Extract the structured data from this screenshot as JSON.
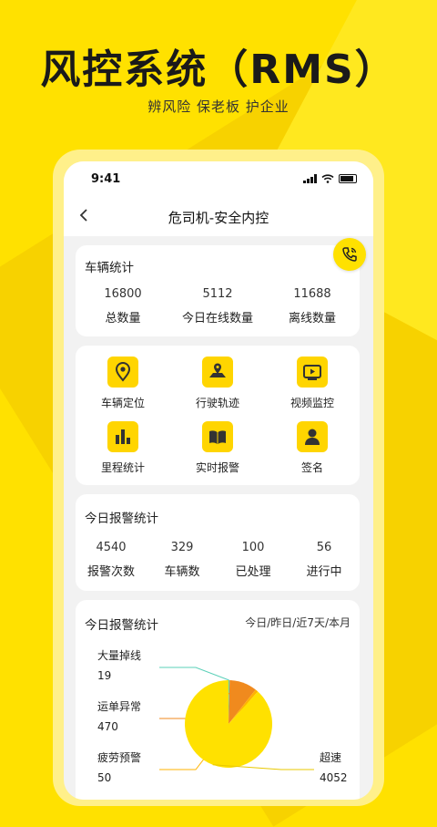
{
  "hero": {
    "title": "风控系统（RMS）",
    "subtitle": "辨风险 保老板 护企业"
  },
  "statusbar": {
    "time": "9:41"
  },
  "nav": {
    "back_icon": "chevron-left-icon",
    "title": "危司机-安全内控"
  },
  "vehicle_stats": {
    "title": "车辆统计",
    "items": [
      {
        "value": "16800",
        "label": "总数量"
      },
      {
        "value": "5112",
        "label": "今日在线数量"
      },
      {
        "value": "11688",
        "label": "离线数量"
      }
    ]
  },
  "functions": [
    {
      "label": "车辆定位",
      "icon": "location-pin-icon"
    },
    {
      "label": "行驶轨迹",
      "icon": "map-route-icon"
    },
    {
      "label": "视频监控",
      "icon": "video-play-icon"
    },
    {
      "label": "里程统计",
      "icon": "bar-chart-icon"
    },
    {
      "label": "实时报警",
      "icon": "book-icon"
    },
    {
      "label": "签名",
      "icon": "person-icon"
    }
  ],
  "alarm_stats": {
    "title": "今日报警统计",
    "items": [
      {
        "value": "4540",
        "label": "报警次数"
      },
      {
        "value": "329",
        "label": "车辆数"
      },
      {
        "value": "100",
        "label": "已处理"
      },
      {
        "value": "56",
        "label": "进行中"
      }
    ]
  },
  "alarm_chart": {
    "title": "今日报警统计",
    "range": "今日/昨日/近7天/本月"
  },
  "chart_data": {
    "type": "pie",
    "slices": [
      {
        "label": "大量掉线",
        "value": 19,
        "color": "#5BD0B8"
      },
      {
        "label": "运单异常",
        "value": 470,
        "color": "#F08A1E"
      },
      {
        "label": "疲劳预警",
        "value": 50,
        "color": "#FFB300"
      },
      {
        "label": "超速",
        "value": 4052,
        "color": "#FFE100"
      }
    ],
    "value_labels": [
      "19",
      "470",
      "50",
      "4052"
    ]
  },
  "colors": {
    "accent": "#FFE100",
    "background": "#F2F2F2"
  }
}
